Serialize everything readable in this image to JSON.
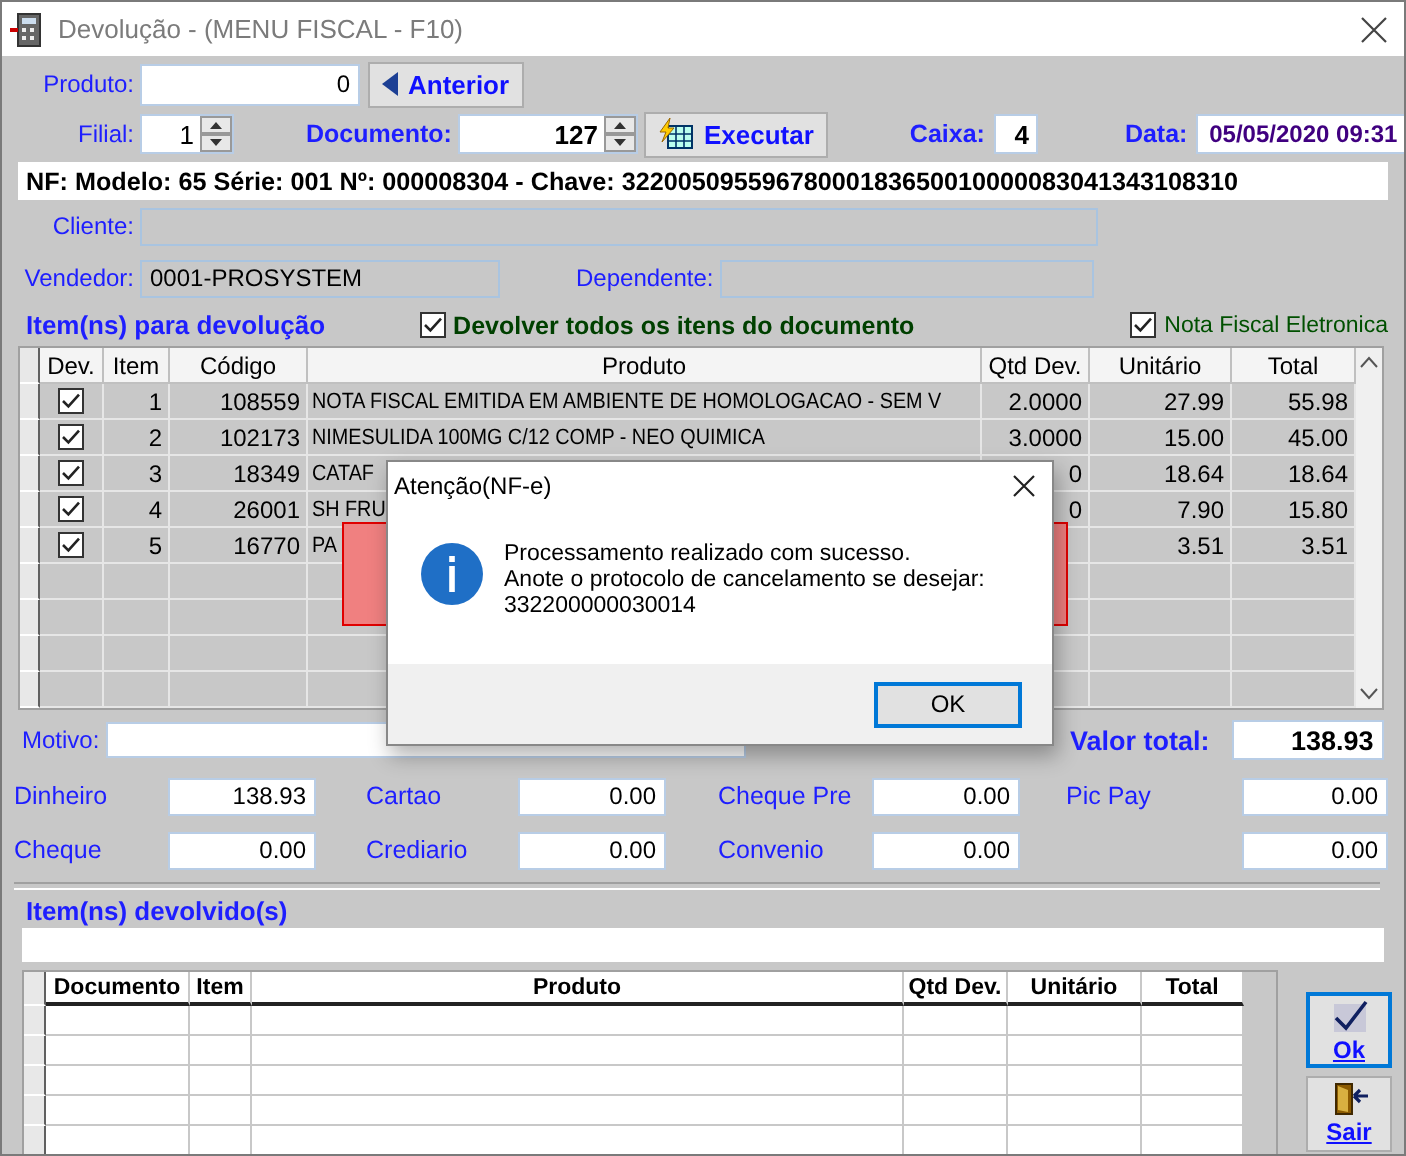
{
  "window": {
    "title": "Devolução - (MENU FISCAL - F10)"
  },
  "header": {
    "produto_label": "Produto:",
    "produto_value": "0",
    "anterior_button": "Anterior",
    "filial_label": "Filial:",
    "filial_value": "1",
    "documento_label": "Documento:",
    "documento_value": "127",
    "executar_button": "Executar",
    "caixa_label": "Caixa:",
    "caixa_value": "4",
    "data_label": "Data:",
    "data_value": "05/05/2020 09:31"
  },
  "nf_banner": "NF: Modelo: 65 Série: 001 Nº: 000008304 - Chave: 32200509559678000183650010000083041343108310",
  "cliente": {
    "label": "Cliente:"
  },
  "vendedor": {
    "label": "Vendedor:",
    "value": "0001-PROSYSTEM"
  },
  "dependente": {
    "label": "Dependente:"
  },
  "items_title": "Item(ns) para devolução",
  "return_all": {
    "label": "Devolver todos os itens do documento",
    "checked": true
  },
  "nfe": {
    "label": "Nota Fiscal Eletronica",
    "checked": true
  },
  "table": {
    "columns": [
      "Dev.",
      "Item",
      "Código",
      "Produto",
      "Qtd Dev.",
      "Unitário",
      "Total"
    ],
    "rows": [
      {
        "dev": true,
        "item": "1",
        "codigo": "108559",
        "produto": "NOTA FISCAL EMITIDA EM AMBIENTE DE HOMOLOGACAO - SEM V",
        "qtd": "2.0000",
        "unitario": "27.99",
        "total": "55.98"
      },
      {
        "dev": true,
        "item": "2",
        "codigo": "102173",
        "produto": "NIMESULIDA 100MG C/12 COMP - NEO QUIMICA",
        "qtd": "3.0000",
        "unitario": "15.00",
        "total": "45.00"
      },
      {
        "dev": true,
        "item": "3",
        "codigo": "18349",
        "produto": "CATAF",
        "qtd": "0",
        "unitario": "18.64",
        "total": "18.64"
      },
      {
        "dev": true,
        "item": "4",
        "codigo": "26001",
        "produto": "SH FRU",
        "qtd": "0",
        "unitario": "7.90",
        "total": "15.80"
      },
      {
        "dev": true,
        "item": "5",
        "codigo": "16770",
        "produto": "PA",
        "qtd": "",
        "unitario": "3.51",
        "total": "3.51"
      }
    ]
  },
  "motivo": {
    "label": "Motivo:"
  },
  "valor_total": {
    "label": "Valor total:",
    "value": "138.93"
  },
  "payments": [
    {
      "label": "Dinheiro",
      "value": "138.93"
    },
    {
      "label": "Cartao",
      "value": "0.00"
    },
    {
      "label": "Cheque Pre",
      "value": "0.00"
    },
    {
      "label": "Pic Pay",
      "value": "0.00"
    },
    {
      "label": "Cheque",
      "value": "0.00"
    },
    {
      "label": "Crediario",
      "value": "0.00"
    },
    {
      "label": "Convenio",
      "value": "0.00"
    },
    {
      "value": "0.00"
    }
  ],
  "returned_title": "Item(ns) devolvido(s)",
  "returned_table": {
    "columns": [
      "Documento",
      "Item",
      "Produto",
      "Qtd Dev.",
      "Unitário",
      "Total"
    ]
  },
  "buttons": {
    "ok": "Ok",
    "sair": "Sair"
  },
  "dialog": {
    "title": "Atenção(NF-e)",
    "message": [
      "Processamento realizado com sucesso.",
      "Anote o protocolo de cancelamento se desejar:",
      "332200000030014"
    ],
    "ok_button": "OK"
  }
}
